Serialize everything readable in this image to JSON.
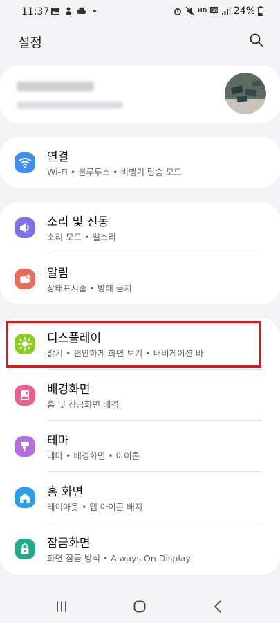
{
  "status_bar": {
    "time": "11:37",
    "battery_percent": "24%"
  },
  "header": {
    "title": "설정"
  },
  "groups": [
    {
      "items": [
        {
          "title": "연결",
          "subtitle": "Wi-Fi  •  블루투스  •  비행기 탑승 모드",
          "icon": "wifi-icon",
          "color": "#3d8ef2"
        }
      ]
    },
    {
      "items": [
        {
          "title": "소리 및 진동",
          "subtitle": "소리 모드  •  벨소리",
          "icon": "volume-icon",
          "color": "#7b72e8"
        },
        {
          "title": "알림",
          "subtitle": "상태표시줄  •  방해 금지",
          "icon": "notification-icon",
          "color": "#ee6a5a"
        }
      ]
    },
    {
      "items": [
        {
          "title": "디스플레이",
          "subtitle": "밝기  •  편안하게 화면 보기  •  내비게이션 바",
          "icon": "brightness-icon",
          "color": "#8ccc25"
        },
        {
          "title": "배경화면",
          "subtitle": "홈 및 잠금화면 배경",
          "icon": "wallpaper-icon",
          "color": "#e8608d"
        },
        {
          "title": "테마",
          "subtitle": "테마  •  배경화면  •  아이콘",
          "icon": "theme-icon",
          "color": "#b36ee0"
        },
        {
          "title": "홈 화면",
          "subtitle": "레이아웃  •  앱 아이콘 배지",
          "icon": "home-icon",
          "color": "#2c9fe6"
        },
        {
          "title": "잠금화면",
          "subtitle": "화면 잠금 방식  •  Always On Display",
          "icon": "lock-icon",
          "color": "#22a987"
        }
      ]
    }
  ]
}
